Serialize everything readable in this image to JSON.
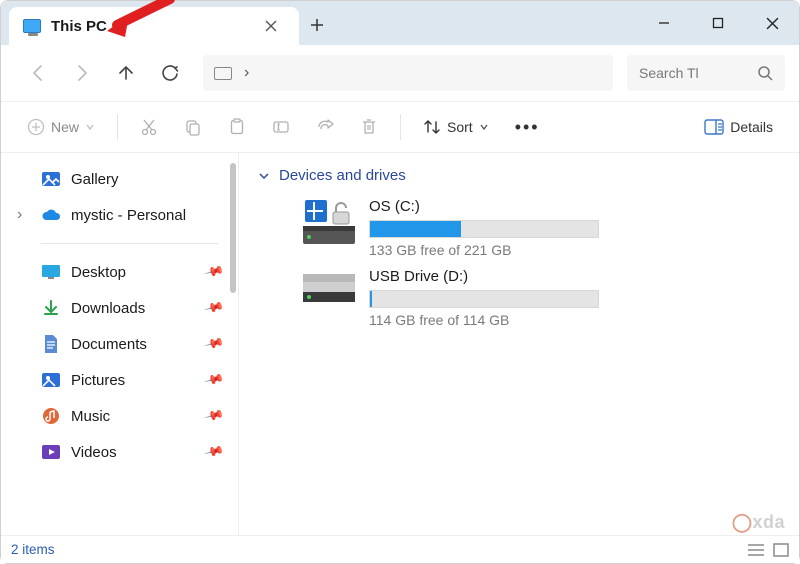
{
  "window": {
    "tab_title": "This PC",
    "search_placeholder": "Search Tl"
  },
  "toolbar": {
    "new_label": "New",
    "sort_label": "Sort",
    "details_label": "Details"
  },
  "sidebar": {
    "gallery": "Gallery",
    "onedrive": "mystic - Personal",
    "desktop": "Desktop",
    "downloads": "Downloads",
    "documents": "Documents",
    "pictures": "Pictures",
    "music": "Music",
    "videos": "Videos"
  },
  "content": {
    "section": "Devices and drives",
    "drives": [
      {
        "name": "OS (C:)",
        "info": "133 GB free of 221 GB",
        "fill_pct": 40
      },
      {
        "name": "USB Drive (D:)",
        "info": "114 GB free of 114 GB",
        "fill_pct": 1
      }
    ]
  },
  "status": {
    "items": "2 items"
  },
  "watermark": "xda"
}
